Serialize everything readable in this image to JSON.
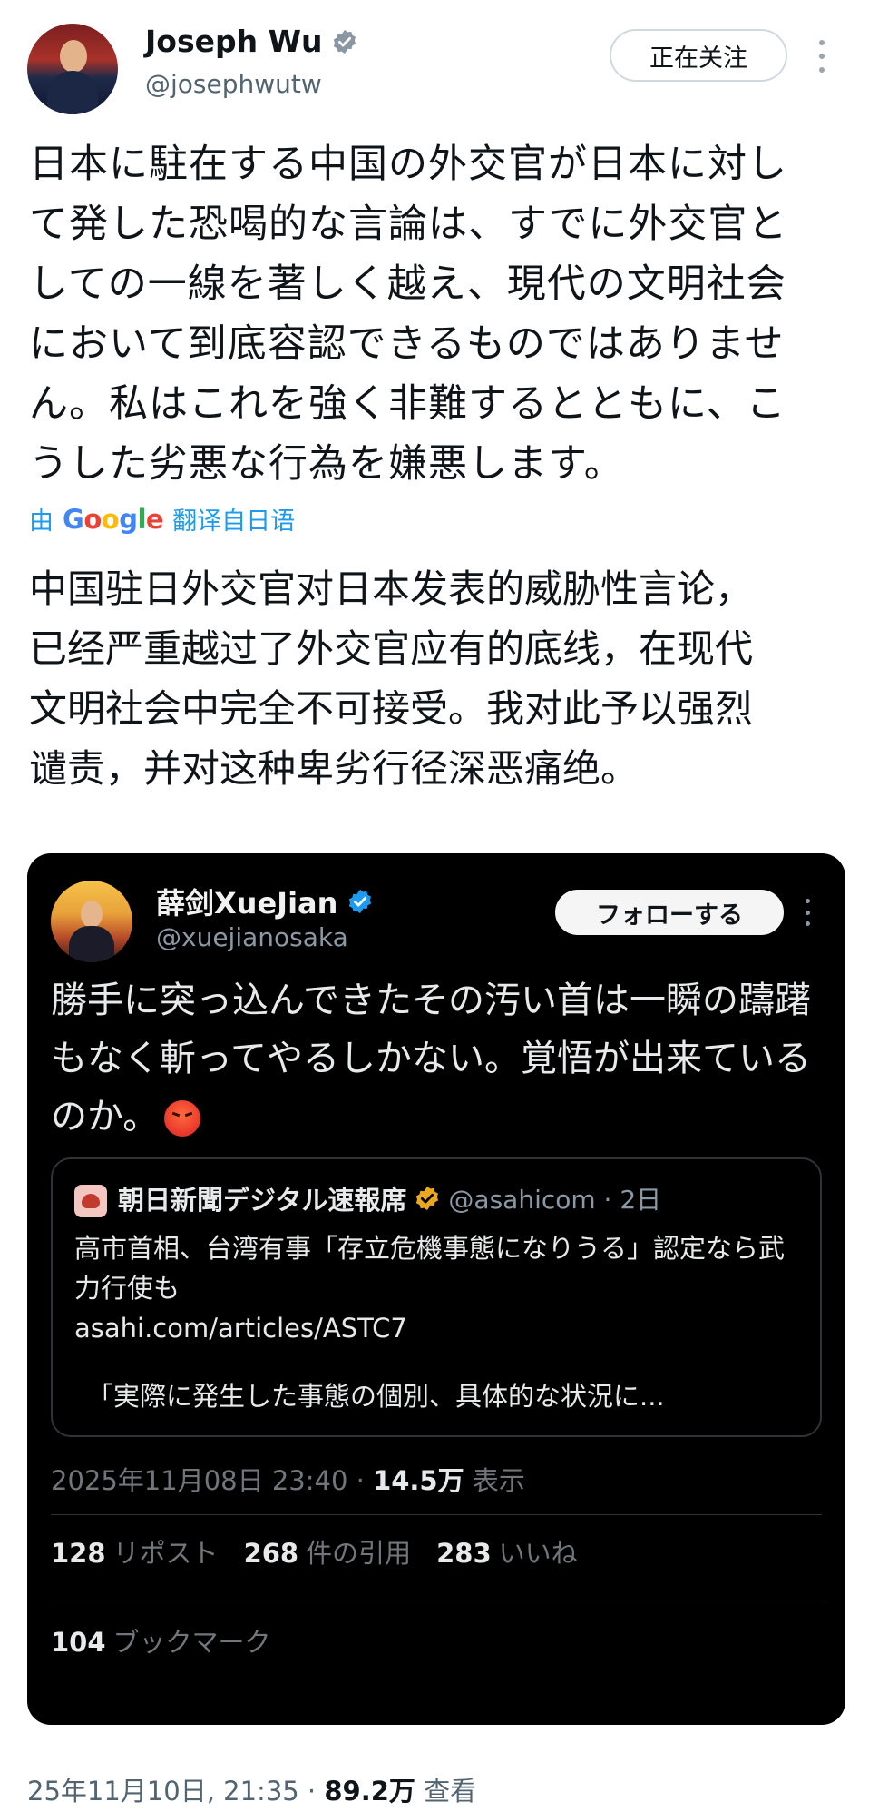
{
  "post": {
    "author_name": "Joseph Wu",
    "author_handle": "@josephwutw",
    "follow_label": "正在关注",
    "text_ja": "日本に駐在する中国の外交官が日本に対し\nて発した恐喝的な言論は、すでに外交官と\nしての一線を著しく越え、現代の文明社会\nにおいて到底容認できるものではありませ\nん。私はこれを強く非難するとともに、こ\nうした劣悪な行為を嫌悪します。",
    "translate_prefix": "由",
    "translate_brand": "Google",
    "translate_suffix": "翻译自日语",
    "text_zh": "中国驻日外交官对日本发表的威胁性言论，\n已经严重越过了外交官应有的底线，在现代\n文明社会中完全不可接受。我对此予以强烈\n谴责，并对这种卑劣行径深恶痛绝。",
    "footer_date": "25年11月10日, 21:35 · ",
    "footer_views": "89.2万",
    "footer_views_label": " 查看"
  },
  "embedded": {
    "author_name": "薛剑XueJian",
    "author_handle": "@xuejianosaka",
    "follow_label": "フォローする",
    "text": "勝手に突っ込んできたその汚い首は一瞬の躊躇もなく斬ってやるしかない。覚悟が出来ているのか。",
    "quote": {
      "name": "朝日新聞デジタル速報席",
      "meta": "@asahicom · 2日",
      "body": "高市首相、台湾有事「存立危機事態になりうる」認定なら武力行使も",
      "link": "asahi.com/articles/ASTC7",
      "body2": "「実際に発生した事態の個別、具体的な状況に..."
    },
    "date": "2025年11月08日 23:40 · ",
    "views": "14.5万",
    "views_label": " 表示",
    "reposts_count": "128",
    "reposts_label": "リポスト",
    "quotes_count": "268",
    "quotes_label": "件の引用",
    "likes_count": "283",
    "likes_label": "いいね",
    "bookmarks_count": "104",
    "bookmarks_label": "ブックマーク"
  },
  "colors": {
    "accent": "#1d9bf0",
    "card_bg": "#000000",
    "gold_badge": "#e8a81f"
  }
}
